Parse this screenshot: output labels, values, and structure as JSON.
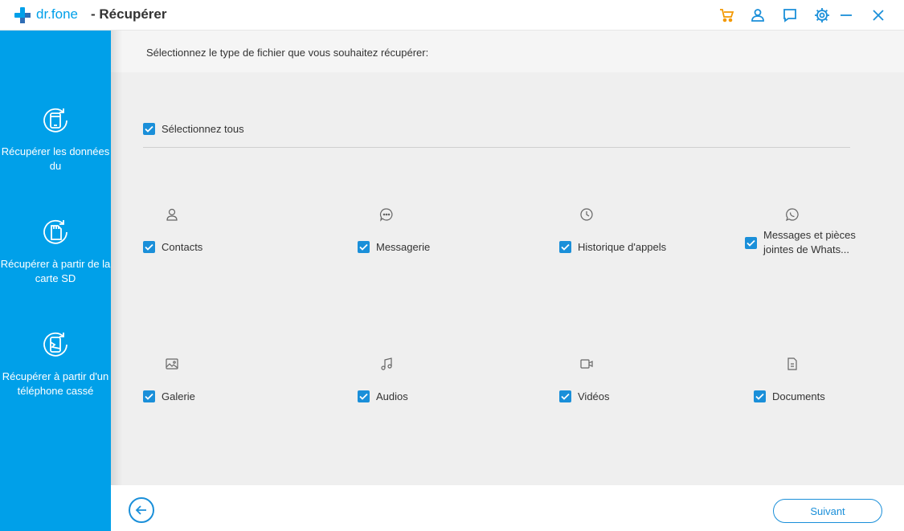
{
  "app": {
    "brand": "dr.fone",
    "title": "- Récupérer"
  },
  "titlebar": {
    "icons": [
      "cart-icon",
      "user-icon",
      "feedback-icon",
      "settings-icon",
      "minimize-icon",
      "close-icon"
    ],
    "colors": {
      "cart": "#f39800",
      "icon": "#1a8fd9"
    }
  },
  "sidebar": {
    "background": "#00a0e9",
    "items": [
      {
        "label": "Récupérer les données du",
        "icon": "phone-recover-icon"
      },
      {
        "label": "Récupérer à partir de la carte SD",
        "icon": "sd-card-recover-icon"
      },
      {
        "label": "Récupérer à partir d'un téléphone cassé",
        "icon": "broken-phone-recover-icon"
      }
    ]
  },
  "main": {
    "instruction": "Sélectionnez le type de fichier que vous souhaitez récupérer:",
    "select_all": {
      "label": "Sélectionnez tous",
      "checked": true
    },
    "types": [
      {
        "label": "Contacts",
        "icon": "contacts-icon",
        "checked": true
      },
      {
        "label": "Messagerie",
        "icon": "messages-icon",
        "checked": true
      },
      {
        "label": "Historique d'appels",
        "icon": "call-history-icon",
        "checked": true
      },
      {
        "label": "Messages et pièces jointes de Whats...",
        "icon": "whatsapp-icon",
        "checked": true
      },
      {
        "label": "Galerie",
        "icon": "gallery-icon",
        "checked": true
      },
      {
        "label": "Audios",
        "icon": "audio-icon",
        "checked": true
      },
      {
        "label": "Vidéos",
        "icon": "video-icon",
        "checked": true
      },
      {
        "label": "Documents",
        "icon": "documents-icon",
        "checked": true
      }
    ]
  },
  "footer": {
    "next_label": "Suivant"
  }
}
